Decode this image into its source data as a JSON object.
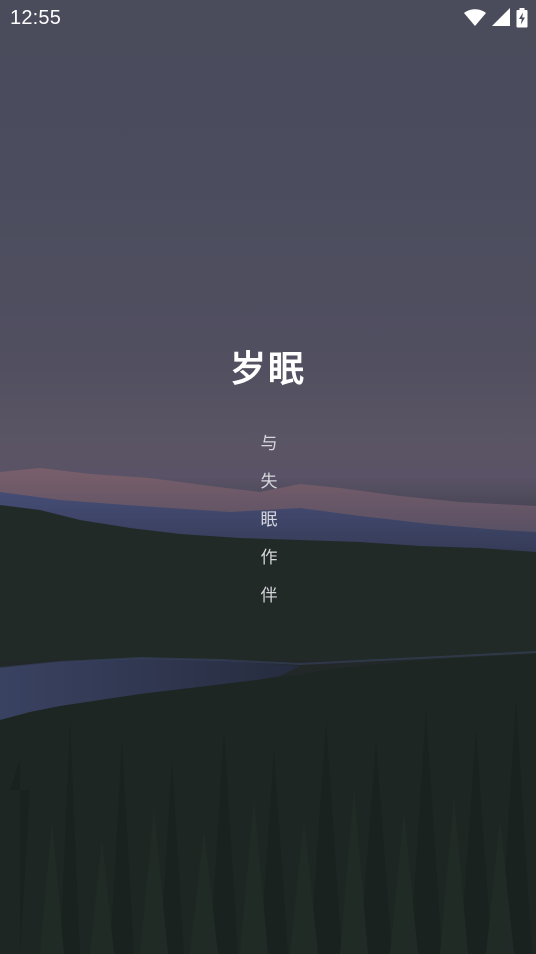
{
  "status_bar": {
    "time": "12:55",
    "icons": [
      "wifi-icon",
      "cellular-signal-icon",
      "battery-charging-icon"
    ]
  },
  "app": {
    "title": "岁眠",
    "slogan_chars": [
      "与",
      "失",
      "眠",
      "作",
      "伴"
    ]
  },
  "colors": {
    "sky": "#4b4d5e",
    "forest": "#1e2522",
    "lake": "#2e3550",
    "text": "#ffffff"
  }
}
